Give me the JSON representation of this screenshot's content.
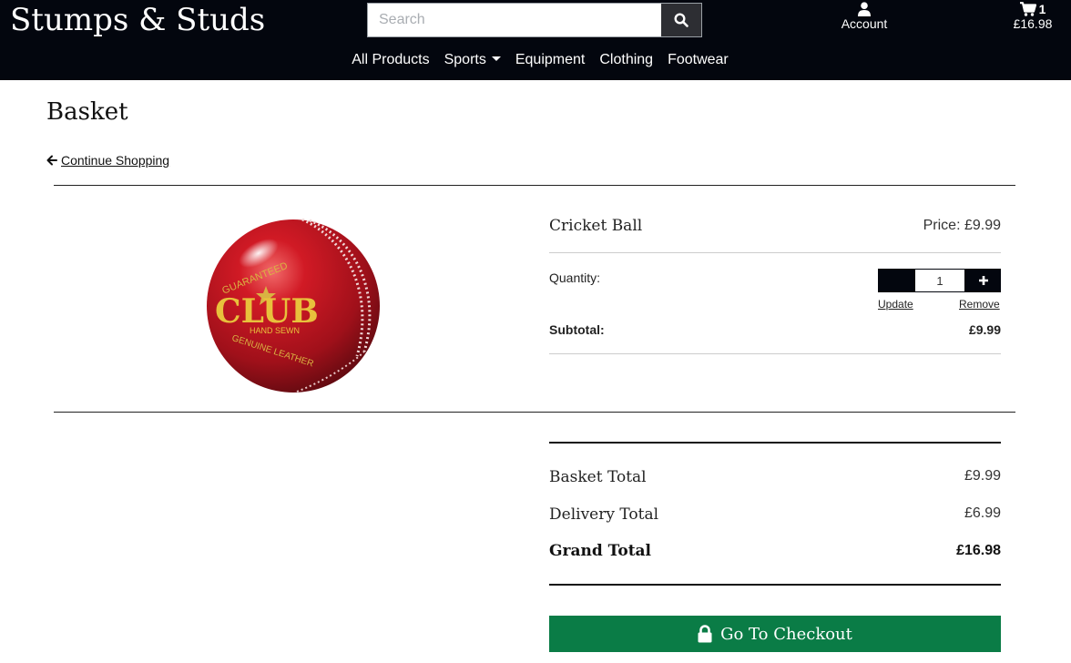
{
  "header": {
    "brand": "Stumps & Studs",
    "search_placeholder": "Search",
    "account_label": "Account",
    "cart_count": "1",
    "cart_total": "£16.98",
    "nav": [
      "All Products",
      "Sports",
      "Equipment",
      "Clothing",
      "Footwear"
    ]
  },
  "page": {
    "title": "Basket",
    "continue_label": "Continue Shopping"
  },
  "item": {
    "name": "Cricket Ball",
    "price": "Price: £9.99",
    "quantity_label": "Quantity:",
    "quantity": "1",
    "update_label": "Update",
    "remove_label": "Remove",
    "subtotal_label": "Subtotal:",
    "subtotal": "£9.99",
    "ball_text": {
      "top": "GUARANTEED",
      "main": "CLUB",
      "mid": "HAND SEWN",
      "bottom": "GENUINE LEATHER"
    }
  },
  "totals": {
    "basket_label": "Basket Total",
    "basket_value": "£9.99",
    "delivery_label": "Delivery Total",
    "delivery_value": "£6.99",
    "grand_label": "Grand Total",
    "grand_value": "£16.98"
  },
  "checkout_label": "Go To Checkout",
  "colors": {
    "header_bg": "#03060e",
    "checkout_bg": "#0a7c46",
    "ball_red": "#b3121f"
  },
  "icons": [
    "search-icon",
    "user-icon",
    "cart-icon",
    "arrow-left-icon",
    "lock-icon"
  ]
}
